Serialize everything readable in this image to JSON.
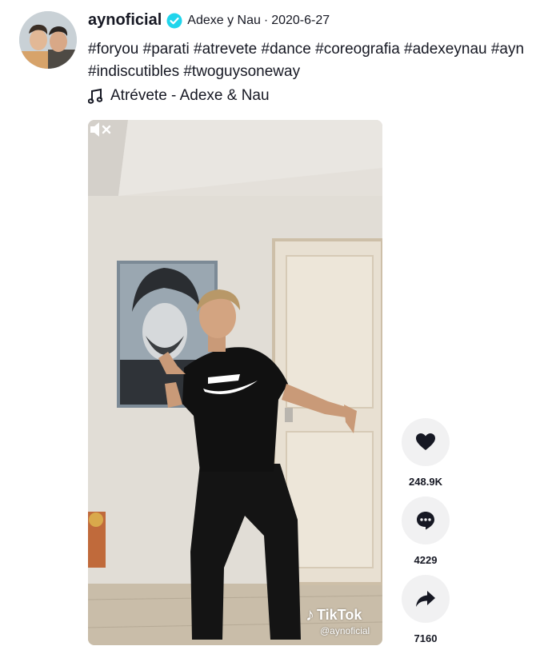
{
  "post": {
    "username": "aynoficial",
    "nickname": "Adexe y Nau",
    "separator": "·",
    "date": "2020-6-27",
    "verified_icon": "verified-badge-icon",
    "caption_line1": "#foryou #parati #atrevete #dance #coreografia #adexeynau #ayn",
    "caption_line2": "#indiscutibles #twoguysoneway",
    "music_icon": "music-note-icon",
    "music": "Atrévete - Adexe & Nau"
  },
  "video": {
    "watermark_brand": "TikTok",
    "watermark_handle": "@aynoficial",
    "mute_icon": "muted-speaker-icon"
  },
  "actions": [
    {
      "icon": "heart-icon",
      "count": "248.9K"
    },
    {
      "icon": "comment-icon",
      "count": "4229"
    },
    {
      "icon": "share-icon",
      "count": "7160"
    }
  ],
  "colors": {
    "text": "#161823",
    "verified": "#20d5ec",
    "action_bg": "#f1f1f2"
  }
}
